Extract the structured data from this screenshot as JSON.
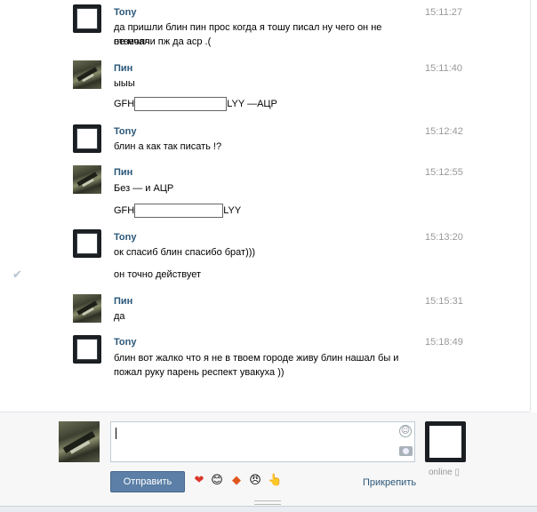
{
  "messages": [
    {
      "author": "Tony",
      "time": "15:11:27",
      "lines": [
        "да пришли блин пин прос когда я тошу писал ну чего он не отвечал",
        "не молчи пж да аср .("
      ]
    },
    {
      "author": "Пин",
      "time": "15:11:40",
      "lines": [
        "ыыы"
      ],
      "redacted_line": {
        "prefix": "GFH",
        "suffix": "LYY —АЦР"
      }
    },
    {
      "author": "Tony",
      "time": "15:12:42",
      "lines": [
        "блин а как так писать !?"
      ]
    },
    {
      "author": "Пин",
      "time": "15:12:55",
      "lines": [
        "Без — и АЦР"
      ],
      "redacted_line": {
        "prefix": "GFH",
        "suffix": "LYY"
      }
    },
    {
      "author": "Tony",
      "time": "15:13:20",
      "lines": [
        "ок спасиб блин спасибо брат)))"
      ],
      "extra_line": "он точно действует"
    },
    {
      "author": "Пин",
      "time": "15:15:31",
      "lines": [
        "да"
      ]
    },
    {
      "author": "Tony",
      "time": "15:18:49",
      "lines": [
        "блин вот жалко что я не в твоем городе живу блин нашал бы и",
        "пожал руку парень респект увакуха ))"
      ]
    }
  ],
  "compose": {
    "send_label": "Отправить",
    "attach_label": "Прикрепить",
    "status": "online",
    "emoji": [
      "❤",
      "😊",
      "◆",
      "😠",
      "👆"
    ]
  }
}
